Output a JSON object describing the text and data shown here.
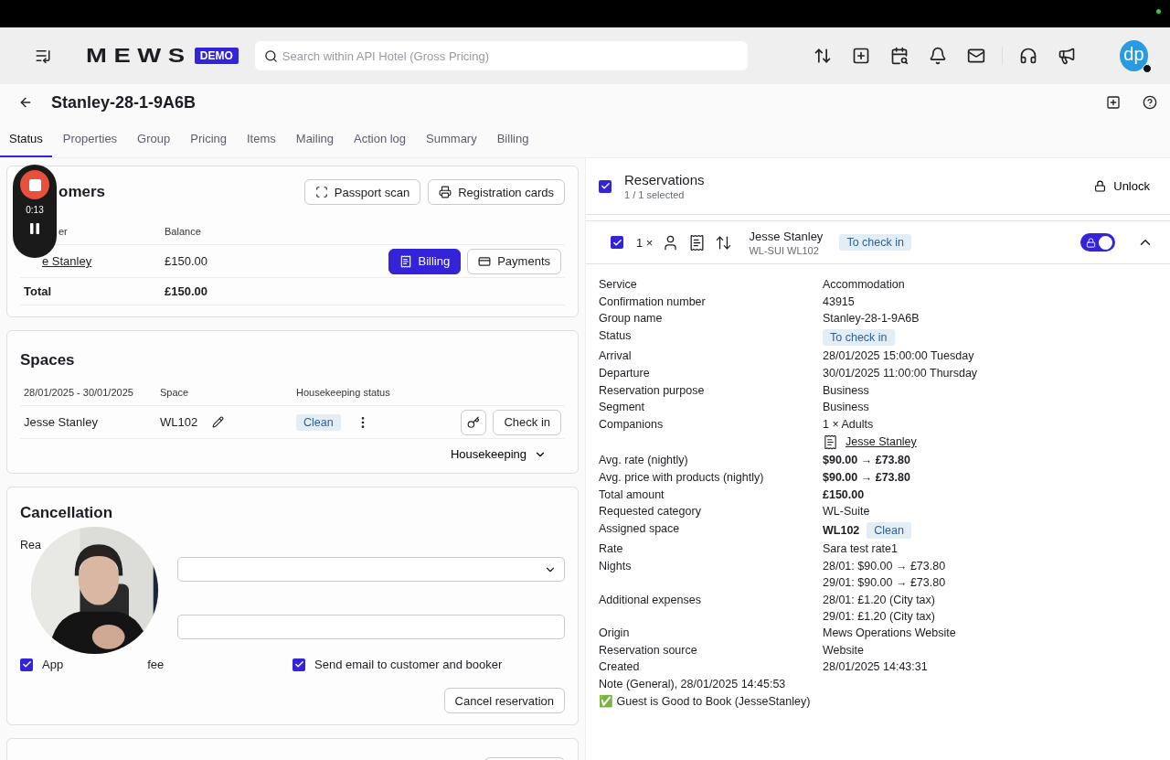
{
  "recorder": {
    "time": "0:13",
    "recording": true
  },
  "topbar": {
    "logo": "MEWS",
    "badge": "DEMO",
    "search": {
      "placeholder": "Search within API Hotel (Gross Pricing)"
    },
    "avatar": "dp"
  },
  "page": {
    "title": "Stanley-28-1-9A6B"
  },
  "tabs": [
    {
      "label": "Status",
      "selected": true
    },
    {
      "label": "Properties",
      "selected": false
    },
    {
      "label": "Group",
      "selected": false
    },
    {
      "label": "Pricing",
      "selected": false
    },
    {
      "label": "Items",
      "selected": false
    },
    {
      "label": "Mailing",
      "selected": false
    },
    {
      "label": "Action log",
      "selected": false
    },
    {
      "label": "Summary",
      "selected": false
    },
    {
      "label": "Billing",
      "selected": false
    }
  ],
  "customers": {
    "title": "omers",
    "buttons": [
      "Passport scan",
      "Registration cards"
    ],
    "columns": [
      "er",
      "Balance"
    ],
    "rows": [
      {
        "name": "e Stanley",
        "balance": "£150.00"
      }
    ],
    "row_buttons": [
      {
        "label": "Billing",
        "primary": true
      },
      {
        "label": "Payments",
        "primary": false
      }
    ],
    "total": {
      "label": "Total",
      "value": "£150.00"
    }
  },
  "spaces": {
    "title": "Spaces",
    "columns": [
      "28/01/2025 - 30/01/2025",
      "Space",
      "Housekeeping status"
    ],
    "rows": [
      {
        "guest": "Jesse Stanley",
        "space": "WL102",
        "status": "Clean",
        "action": "Check in"
      }
    ],
    "menu": "Housekeeping"
  },
  "cancellation": {
    "title": "Cancellation",
    "reason_label": "Rea",
    "options": [
      {
        "parts": [
          "App",
          "fee"
        ],
        "checked": true
      },
      {
        "parts": [
          "Send email to customer and booker"
        ],
        "checked": true
      }
    ],
    "button": "Cancel reservation"
  },
  "reservations": {
    "title": "Reservations",
    "subtitle": "1 / 1 selected",
    "checked": true,
    "unlock": "Unlock",
    "item": {
      "checked": true,
      "count": "1 ×",
      "name": "Jesse Stanley",
      "code": "WL-SUI WL102",
      "status": "To check in",
      "locked": true,
      "expanded": true
    },
    "details": [
      {
        "label": "Service",
        "kind": "text",
        "lines": [
          "Accommodation"
        ]
      },
      {
        "label": "Confirmation number",
        "kind": "text",
        "lines": [
          "43915"
        ]
      },
      {
        "label": "Group name",
        "kind": "text",
        "lines": [
          "Stanley-28-1-9A6B"
        ]
      },
      {
        "label": "Status",
        "kind": "badge",
        "lines": [
          "To check in"
        ]
      },
      {
        "label": "Arrival",
        "kind": "text",
        "lines": [
          "28/01/2025 15:00:00 Tuesday"
        ]
      },
      {
        "label": "Departure",
        "kind": "text",
        "lines": [
          "30/01/2025 11:00:00 Thursday"
        ]
      },
      {
        "label": "Reservation purpose",
        "kind": "text",
        "lines": [
          "Business"
        ]
      },
      {
        "label": "Segment",
        "kind": "text",
        "lines": [
          "Business"
        ]
      },
      {
        "label": "Companions",
        "kind": "companions",
        "lines": [
          "1 × Adults"
        ],
        "link": "Jesse Stanley"
      },
      {
        "label": "Avg. rate (nightly)",
        "kind": "bold",
        "lines": [
          "$90.00 → £73.80"
        ]
      },
      {
        "label": "Avg. price with products (nightly)",
        "kind": "bold",
        "lines": [
          "$90.00 → £73.80"
        ]
      },
      {
        "label": "Total amount",
        "kind": "bold",
        "lines": [
          "£150.00"
        ]
      },
      {
        "label": "Requested category",
        "kind": "text",
        "lines": [
          "WL-Suite"
        ]
      },
      {
        "label": "Assigned space",
        "kind": "space",
        "lines": [
          "WL102"
        ],
        "badge": "Clean"
      },
      {
        "label": "Rate",
        "kind": "text",
        "lines": [
          "Sara test rate1"
        ]
      },
      {
        "label": "Nights",
        "kind": "text",
        "lines": [
          "28/01: $90.00 → £73.80",
          "29/01: $90.00 → £73.80"
        ]
      },
      {
        "label": "Additional expenses",
        "kind": "text",
        "lines": [
          "28/01: £1.20 (City tax)",
          "29/01: £1.20 (City tax)"
        ]
      },
      {
        "label": "Origin",
        "kind": "text",
        "lines": [
          "Mews Operations Website"
        ]
      },
      {
        "label": "Reservation source",
        "kind": "text",
        "lines": [
          "Website"
        ]
      },
      {
        "label": "Created",
        "kind": "text",
        "lines": [
          "28/01/2025 14:43:31"
        ]
      }
    ],
    "notes": [
      "Note (General), 28/01/2025 14:45:53",
      "✅ Guest is Good to Book (JesseStanley)"
    ]
  }
}
